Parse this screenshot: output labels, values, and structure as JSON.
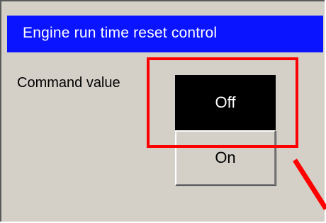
{
  "dialog": {
    "title": "Engine run time reset control",
    "command_label": "Command value",
    "buttons": {
      "off_label": "Off",
      "on_label": "On",
      "selected": "Off"
    }
  },
  "annotation": {
    "highlight_color": "#ff0000"
  },
  "colors": {
    "titlebar": "#0a14ff",
    "panel": "#d4d0c8",
    "selected_button": "#000000"
  }
}
